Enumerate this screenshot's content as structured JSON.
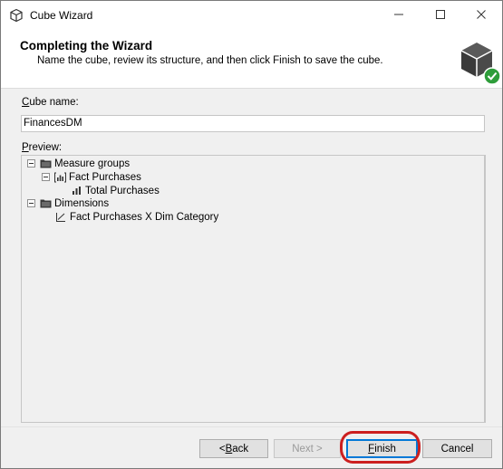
{
  "window": {
    "title": "Cube Wizard",
    "icons": {
      "app": "cube-outline-icon",
      "minimize": "minimize-icon",
      "maximize": "maximize-icon",
      "close": "close-icon"
    }
  },
  "header": {
    "title": "Completing the Wizard",
    "subtitle": "Name the cube, review its structure, and then click Finish to save the cube.",
    "graphic_icon": "cube-check-icon"
  },
  "cube_name": {
    "label_accel": "C",
    "label_rest": "ube name:",
    "value": "FinancesDM"
  },
  "preview": {
    "label_accel": "P",
    "label_rest": "review:",
    "tree": [
      {
        "label": "Measure groups",
        "icon": "folder-icon",
        "level": 0,
        "expanded": true
      },
      {
        "label": "Fact Purchases",
        "icon": "measure-group-icon",
        "level": 1,
        "expanded": true
      },
      {
        "label": "Total Purchases",
        "icon": "measure-icon",
        "level": 2
      },
      {
        "label": "Dimensions",
        "icon": "folder-icon",
        "level": 0,
        "expanded": true
      },
      {
        "label": "Fact Purchases X Dim Category",
        "icon": "dimension-icon",
        "level": 1
      }
    ]
  },
  "buttons": {
    "back_pre": "< ",
    "back_accel": "B",
    "back_rest": "ack",
    "next": "Next >",
    "finish_accel": "F",
    "finish_rest": "inish",
    "cancel": "Cancel"
  },
  "colors": {
    "highlight_ring": "#cc1f1f",
    "check_badge": "#2e9d3a",
    "default_button_border": "#0078d7"
  }
}
